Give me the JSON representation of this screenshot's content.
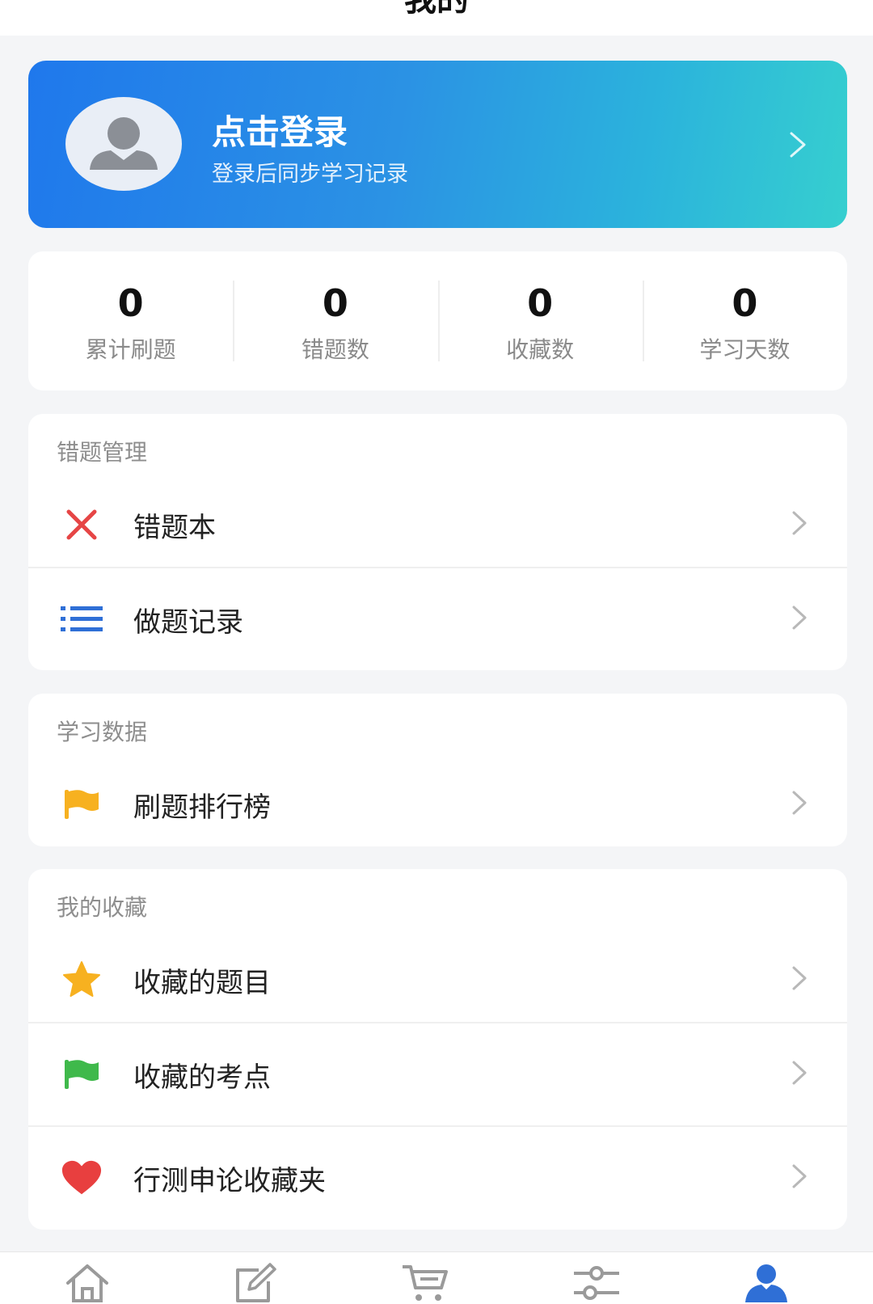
{
  "header": {
    "title": "我的"
  },
  "profile": {
    "login_title": "点击登录",
    "login_subtitle": "登录后同步学习记录"
  },
  "stats": [
    {
      "value": "0",
      "label": "累计刷题"
    },
    {
      "value": "0",
      "label": "错题数"
    },
    {
      "value": "0",
      "label": "收藏数"
    },
    {
      "value": "0",
      "label": "学习天数"
    }
  ],
  "sections": {
    "wrong": {
      "title": "错题管理",
      "items": [
        {
          "label": "错题本",
          "icon": "close-x-icon",
          "color": "#e64545"
        },
        {
          "label": "做题记录",
          "icon": "list-icon",
          "color": "#2f6fd6"
        }
      ]
    },
    "study": {
      "title": "学习数据",
      "items": [
        {
          "label": "刷题排行榜",
          "icon": "flag-icon",
          "color": "#f7b120"
        }
      ]
    },
    "favorites": {
      "title": "我的收藏",
      "items": [
        {
          "label": "收藏的题目",
          "icon": "star-icon",
          "color": "#f7b120"
        },
        {
          "label": "收藏的考点",
          "icon": "flag-icon",
          "color": "#3fb94b"
        },
        {
          "label": "行测申论收藏夹",
          "icon": "heart-icon",
          "color": "#e83f3f"
        }
      ]
    }
  },
  "tabbar": {
    "active_color": "#2f6fd6",
    "inactive_color": "#9a9a9a",
    "tabs": [
      {
        "icon": "home-icon"
      },
      {
        "icon": "edit-icon"
      },
      {
        "icon": "cart-icon"
      },
      {
        "icon": "settings-sliders-icon"
      },
      {
        "icon": "user-icon",
        "active": true
      }
    ]
  }
}
